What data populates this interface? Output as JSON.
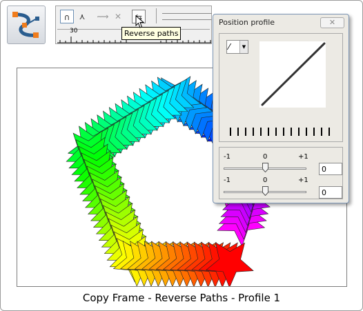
{
  "toolbar": {
    "tooltip": "Reverse paths",
    "ruler_label": "30",
    "tool_icon": "bezier-tool-icon",
    "buttons": [
      "smooth-join-icon",
      "cusp-join-icon",
      "break-path-icon",
      "delete-point-icon",
      "reverse-paths-icon"
    ]
  },
  "dialog": {
    "title": "Position profile",
    "close_label": "✕",
    "profile_picker_icon": "linear-profile-icon",
    "slider1": {
      "min": "-1",
      "mid": "0",
      "max": "+1",
      "value": "0"
    },
    "slider2": {
      "min": "-1",
      "mid": "0",
      "max": "+1",
      "value": "0"
    }
  },
  "canvas": {
    "content": "rainbow-star-blend-pentagon"
  },
  "caption": "Copy Frame - Reverse Paths - Profile 1",
  "colors": {
    "accent": "#3b78b0",
    "dialog_bg": "#eceae4",
    "tooltip_bg": "#ffffe1",
    "tool_blue": "#2a5d8f",
    "tool_orange": "#f07c1c"
  }
}
